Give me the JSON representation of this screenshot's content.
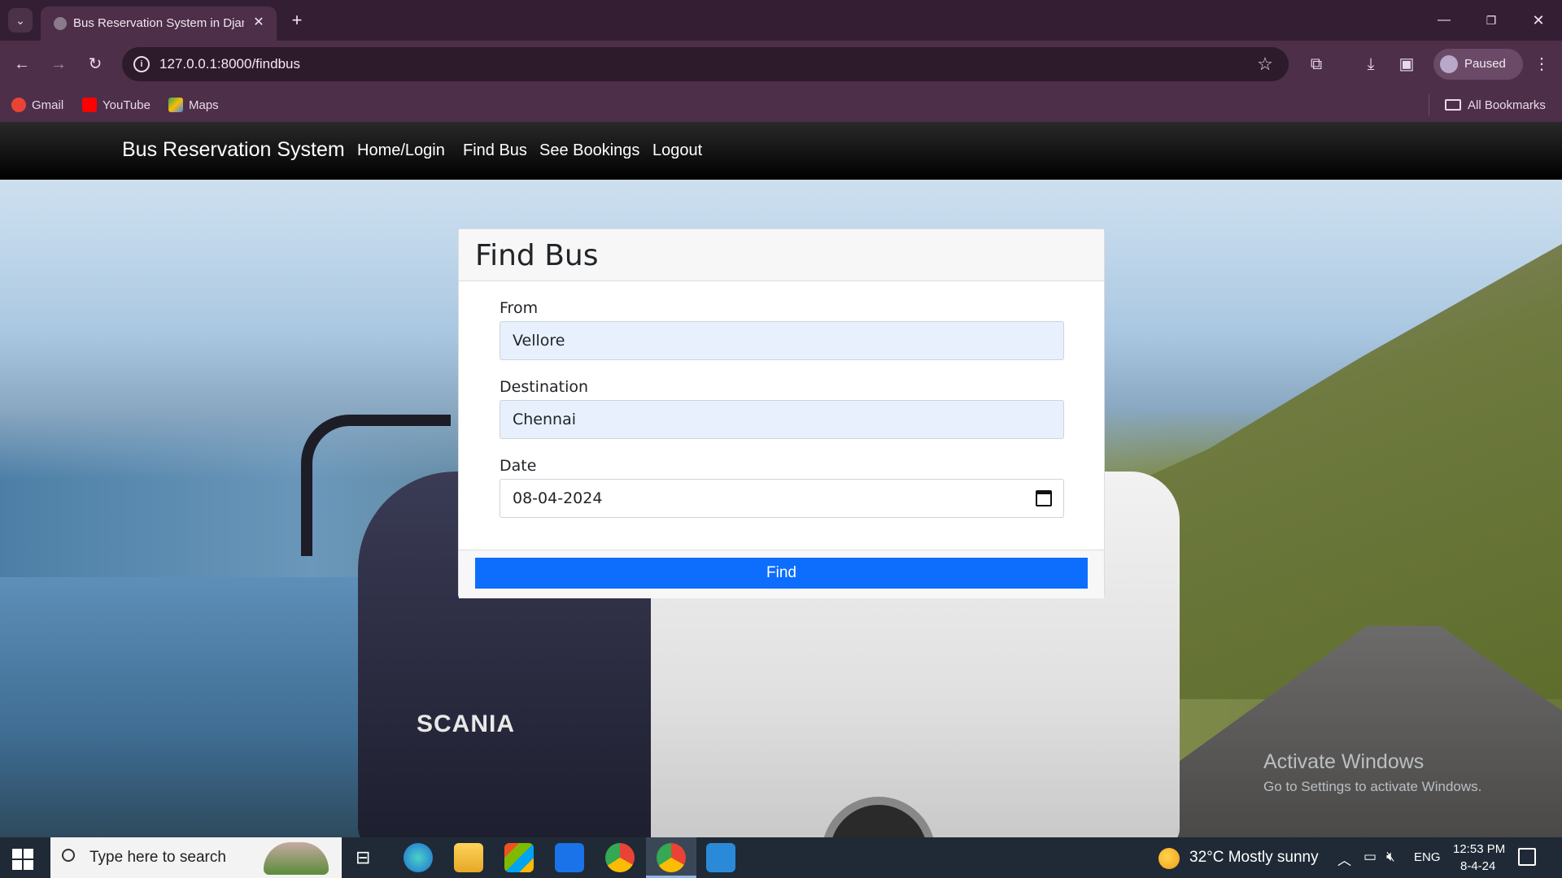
{
  "browser": {
    "tab_title": "Bus Reservation System in Djan",
    "url": "127.0.0.1:8000/findbus",
    "profile_status": "Paused",
    "bookmarks": [
      {
        "label": "Gmail",
        "icon": "gmail-icon",
        "color": "#ea4335"
      },
      {
        "label": "YouTube",
        "icon": "youtube-icon",
        "color": "#ff0000"
      },
      {
        "label": "Maps",
        "icon": "maps-icon",
        "color": "#34a853"
      }
    ],
    "all_bookmarks_label": "All Bookmarks"
  },
  "navbar": {
    "brand": "Bus Reservation System",
    "links": [
      "Home/Login",
      "Find Bus",
      "See Bookings",
      "Logout"
    ]
  },
  "find_form": {
    "title": "Find Bus",
    "from_label": "From",
    "from_value": "Vellore",
    "destination_label": "Destination",
    "destination_value": "Chennai",
    "date_label": "Date",
    "date_value": "08-04-2024",
    "submit_label": "Find"
  },
  "bus_logo": "SCANIA",
  "watermark": {
    "title": "Activate Windows",
    "subtitle": "Go to Settings to activate Windows."
  },
  "taskbar": {
    "search_placeholder": "Type here to search",
    "weather": "32°C  Mostly sunny",
    "language": "ENG",
    "time": "12:53 PM",
    "date": "8-4-24",
    "accent_color": "#0d6efd"
  }
}
